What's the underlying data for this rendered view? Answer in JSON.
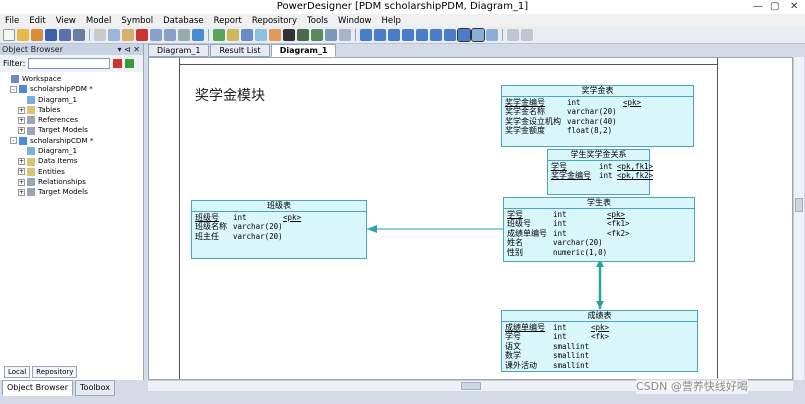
{
  "window": {
    "title": "PowerDesigner [PDM scholarshipPDM, Diagram_1]"
  },
  "menu": [
    "File",
    "Edit",
    "View",
    "Model",
    "Symbol",
    "Database",
    "Report",
    "Repository",
    "Tools",
    "Window",
    "Help"
  ],
  "object_browser": {
    "title": "Object Browser",
    "filter_label": "Filter:",
    "tree": [
      {
        "label": "Workspace",
        "level": 0
      },
      {
        "label": "scholarshipPDM *",
        "level": 1,
        "expander": "-"
      },
      {
        "label": "Diagram_1",
        "level": 2
      },
      {
        "label": "Tables",
        "level": 2,
        "expander": "+"
      },
      {
        "label": "References",
        "level": 2,
        "expander": "+"
      },
      {
        "label": "Target Models",
        "level": 2,
        "expander": "+"
      },
      {
        "label": "scholarshipCDM *",
        "level": 1,
        "expander": "-"
      },
      {
        "label": "Diagram_1",
        "level": 2
      },
      {
        "label": "Data Items",
        "level": 2,
        "expander": "+"
      },
      {
        "label": "Entities",
        "level": 2,
        "expander": "+"
      },
      {
        "label": "Relationships",
        "level": 2,
        "expander": "+"
      },
      {
        "label": "Target Models",
        "level": 2,
        "expander": "+"
      }
    ],
    "local_tabs": [
      "Local",
      "Repository"
    ],
    "bottom_tabs": [
      "Object Browser",
      "Toolbox"
    ]
  },
  "doc_tabs": [
    "Diagram_1",
    "Result List",
    "Diagram_1"
  ],
  "diagram": {
    "title": "奖学金模块",
    "entities": {
      "scholarship": {
        "name": "奖学金表",
        "attrs": [
          {
            "n": "奖学金编号",
            "t": "int",
            "k": "<pk>",
            "u": true
          },
          {
            "n": "奖学金名称",
            "t": "varchar(20)",
            "k": ""
          },
          {
            "n": "奖学金设立机构",
            "t": "varchar(40)",
            "k": ""
          },
          {
            "n": "奖学金额度",
            "t": "float(8,2)",
            "k": ""
          }
        ]
      },
      "relation": {
        "name": "学生奖学金关系",
        "attrs": [
          {
            "n": "学号",
            "t": "int",
            "k": "<pk,fk1>",
            "u": true
          },
          {
            "n": "奖学金编号",
            "t": "int",
            "k": "<pk,fk2>",
            "u": true
          }
        ]
      },
      "class": {
        "name": "班级表",
        "attrs": [
          {
            "n": "班级号",
            "t": "int",
            "k": "<pk>",
            "u": true
          },
          {
            "n": "班级名称",
            "t": "varchar(20)",
            "k": ""
          },
          {
            "n": "班主任",
            "t": "varchar(20)",
            "k": ""
          }
        ]
      },
      "student": {
        "name": "学生表",
        "attrs": [
          {
            "n": "学号",
            "t": "int",
            "k": "<pk>",
            "u": true
          },
          {
            "n": "班级号",
            "t": "int",
            "k": "<fk1>"
          },
          {
            "n": "成绩单编号",
            "t": "int",
            "k": "<fk2>"
          },
          {
            "n": "姓名",
            "t": "varchar(20)",
            "k": ""
          },
          {
            "n": "性别",
            "t": "numeric(1,0)",
            "k": ""
          }
        ]
      },
      "grades": {
        "name": "成绩表",
        "attrs": [
          {
            "n": "成绩单编号",
            "t": "int",
            "k": "<pk>",
            "u": true
          },
          {
            "n": "学号",
            "t": "int",
            "k": "<fk>"
          },
          {
            "n": "语文",
            "t": "smallint",
            "k": ""
          },
          {
            "n": "数学",
            "t": "smallint",
            "k": ""
          },
          {
            "n": "课外活动",
            "t": "smallint",
            "k": ""
          }
        ]
      }
    }
  },
  "watermark": "CSDN @营养快线好喝",
  "colors": {
    "entity_fill": "#d9f6fa",
    "entity_border": "#4aa8b6",
    "link": "#2aa79b"
  }
}
